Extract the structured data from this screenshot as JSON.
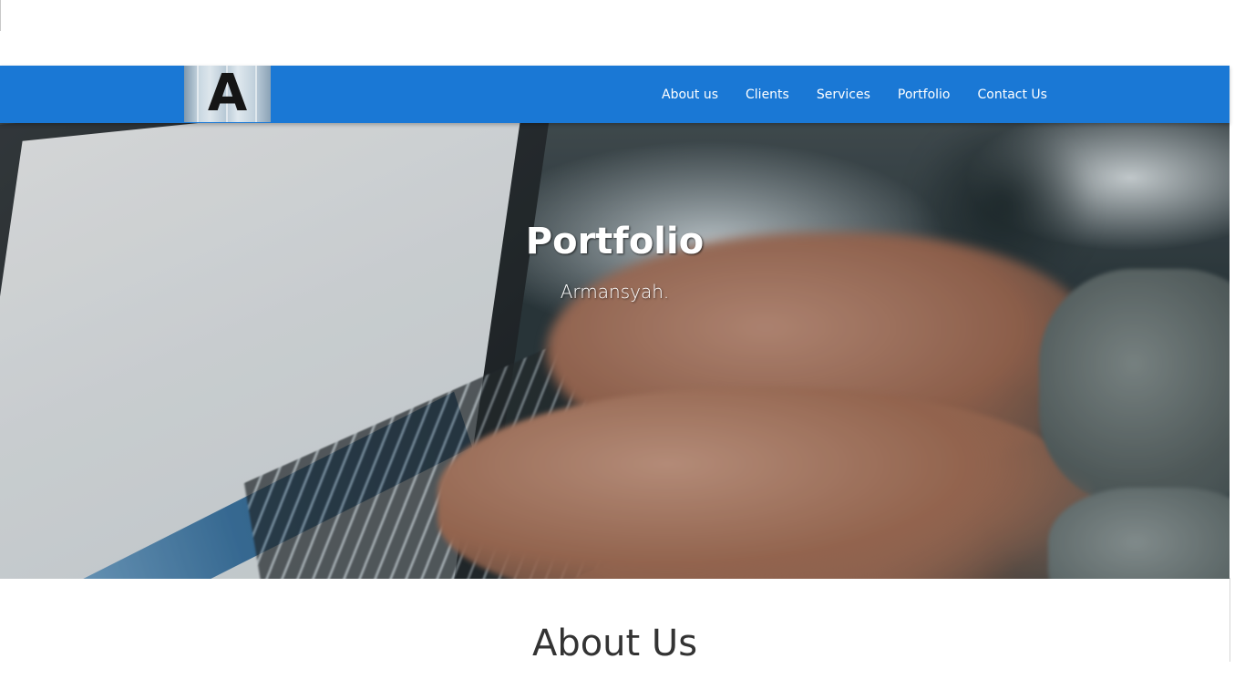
{
  "navbar": {
    "brand_letter": "A",
    "links": [
      {
        "label": "About us"
      },
      {
        "label": "Clients"
      },
      {
        "label": "Services"
      },
      {
        "label": "Portfolio"
      },
      {
        "label": "Contact Us"
      }
    ],
    "background_color": "#1a78d5"
  },
  "hero": {
    "title": "Portfolio",
    "subtitle": "Armansyah."
  },
  "about": {
    "title": "About Us"
  }
}
